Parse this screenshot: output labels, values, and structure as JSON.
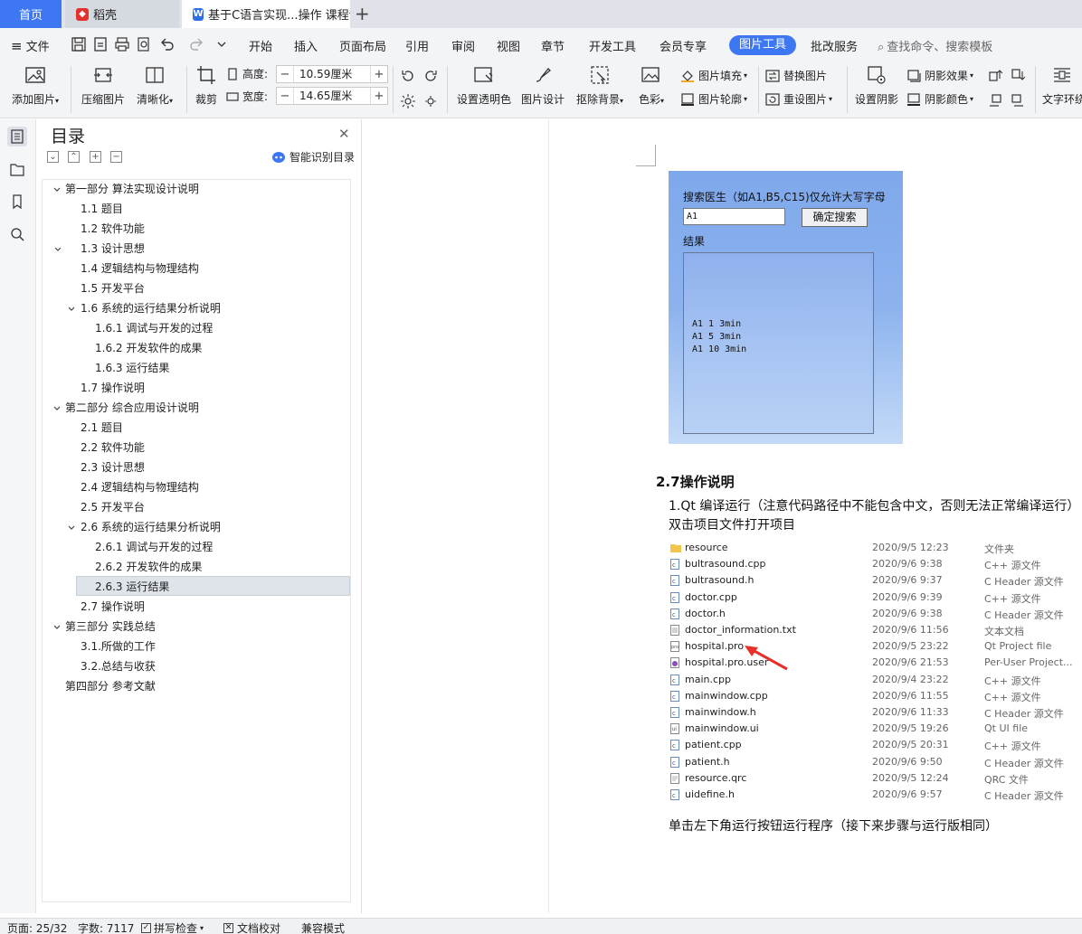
{
  "tabs": {
    "home": "首页",
    "wps": "稻壳",
    "doc": "基于C语言实现...操作 课程论文"
  },
  "menu": {
    "file": "文件",
    "items": [
      "开始",
      "插入",
      "页面布局",
      "引用",
      "审阅",
      "视图",
      "章节",
      "开发工具",
      "会员专享"
    ],
    "picture_tool": "图片工具",
    "review_service": "批改服务",
    "search": "查找命令、搜索模板"
  },
  "ribbon": {
    "add_picture": "添加图片",
    "compress": "压缩图片",
    "clarify": "清晰化",
    "crop": "裁剪",
    "height_label": "高度:",
    "height_value": "10.59厘米",
    "width_label": "宽度:",
    "width_value": "14.65厘米",
    "transparent": "设置透明色",
    "design": "图片设计",
    "remove_bg": "抠除背景",
    "color": "色彩",
    "fill": "图片填充",
    "outline": "图片轮廓",
    "replace": "替换图片",
    "reset": "重设图片",
    "shadow_set": "设置阴影",
    "shadow_effect": "阴影效果",
    "shadow_color": "阴影颜色",
    "wrap": "文字环绕"
  },
  "toc": {
    "title": "目录",
    "smart": "智能识别目录",
    "items": [
      "第一部分  算法实现设计说明",
      "1.1 题目",
      "1.2 软件功能",
      "1.3 设计思想",
      "1.4 逻辑结构与物理结构",
      "1.5 开发平台",
      "1.6 系统的运行结果分析说明",
      "1.6.1  调试与开发的过程",
      "1.6.2  开发软件的成果",
      "1.6.3  运行结果",
      "1.7 操作说明",
      "第二部分  综合应用设计说明",
      "2.1 题目",
      "2.2 软件功能",
      "2.3 设计思想",
      "2.4 逻辑结构与物理结构",
      "2.5 开发平台",
      "2.6 系统的运行结果分析说明",
      "2.6.1  调试与开发的过程",
      "2.6.2  开发软件的成果",
      "2.6.3  运行结果",
      "2.7 操作说明",
      "第三部分  实践总结",
      "3.1.所做的工作",
      "3.2.总结与收获",
      "第四部分  参考文献"
    ]
  },
  "app": {
    "search_label": "搜索医生（如A1,B5,C15)仅允许大写字母",
    "input_value": "A1",
    "search_button": "确定搜索",
    "result_label": "结果",
    "results": [
      "A1 1 3min",
      "A1 5 3min",
      "A1 10 3min"
    ]
  },
  "doc": {
    "heading": "2.7操作说明",
    "para1": "1.Qt 编译运行（注意代码路径中不能包含中文，否则无法正常编译运行）",
    "para2": "双击项目文件打开项目",
    "para3": "单击左下角运行按钮运行程序（接下来步骤与运行版相同）"
  },
  "files": [
    {
      "name": "resource",
      "date": "2020/9/5 12:23",
      "type": "文件夹",
      "icon": "folder-icon"
    },
    {
      "name": "bultrasound.cpp",
      "date": "2020/9/6 9:38",
      "type": "C++ 源文件",
      "icon": "cpp-file-icon"
    },
    {
      "name": "bultrasound.h",
      "date": "2020/9/6 9:37",
      "type": "C Header 源文件",
      "icon": "header-file-icon"
    },
    {
      "name": "doctor.cpp",
      "date": "2020/9/6 9:39",
      "type": "C++ 源文件",
      "icon": "cpp-file-icon"
    },
    {
      "name": "doctor.h",
      "date": "2020/9/6 9:38",
      "type": "C Header 源文件",
      "icon": "header-file-icon"
    },
    {
      "name": "doctor_information.txt",
      "date": "2020/9/6 11:56",
      "type": "文本文档",
      "icon": "text-file-icon"
    },
    {
      "name": "hospital.pro",
      "date": "2020/9/5 23:22",
      "type": "Qt Project file",
      "icon": "pro-file-icon"
    },
    {
      "name": "hospital.pro.user",
      "date": "2020/9/6 21:53",
      "type": "Per-User Project...",
      "icon": "user-file-icon"
    },
    {
      "name": "main.cpp",
      "date": "2020/9/4 23:22",
      "type": "C++ 源文件",
      "icon": "cpp-file-icon"
    },
    {
      "name": "mainwindow.cpp",
      "date": "2020/9/6 11:55",
      "type": "C++ 源文件",
      "icon": "cpp-file-icon"
    },
    {
      "name": "mainwindow.h",
      "date": "2020/9/6 11:33",
      "type": "C Header 源文件",
      "icon": "header-file-icon"
    },
    {
      "name": "mainwindow.ui",
      "date": "2020/9/5 19:26",
      "type": "Qt UI file",
      "icon": "ui-file-icon"
    },
    {
      "name": "patient.cpp",
      "date": "2020/9/5 20:31",
      "type": "C++ 源文件",
      "icon": "cpp-file-icon"
    },
    {
      "name": "patient.h",
      "date": "2020/9/6 9:50",
      "type": "C Header 源文件",
      "icon": "header-file-icon"
    },
    {
      "name": "resource.qrc",
      "date": "2020/9/5 12:24",
      "type": "QRC 文件",
      "icon": "qrc-file-icon"
    },
    {
      "name": "uidefine.h",
      "date": "2020/9/6 9:57",
      "type": "C Header 源文件",
      "icon": "header-file-icon"
    }
  ],
  "status": {
    "page": "页面: 25/32",
    "words": "字数: 7117",
    "spell": "拼写检查",
    "proof": "文档校对",
    "compat": "兼容模式"
  },
  "colors": {
    "accent": "#3d78f2",
    "arrow": "#e8302a",
    "app_bg": "#8db3ee"
  }
}
